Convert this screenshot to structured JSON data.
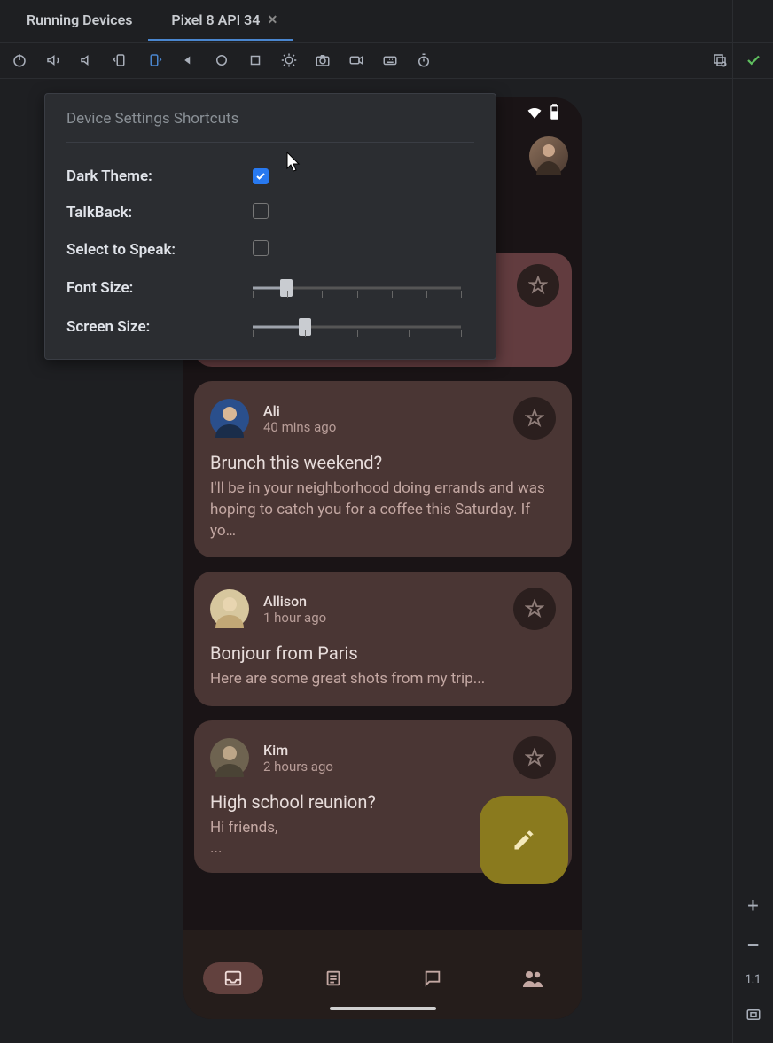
{
  "tabs": {
    "primary": "Running Devices",
    "active": "Pixel 8 API 34"
  },
  "toolbar_icons": [
    "power-icon",
    "volume-up-icon",
    "volume-down-icon",
    "rotate-left-icon",
    "rotate-right-icon",
    "back-icon",
    "home-icon",
    "overview-icon",
    "bug-icon",
    "camera-icon",
    "video-icon",
    "keyboard-icon",
    "timer-icon"
  ],
  "toolbar_right_icons": [
    "snapshot-icon",
    "check-icon"
  ],
  "settings": {
    "title": "Device Settings Shortcuts",
    "dark_theme": {
      "label": "Dark Theme:",
      "checked": true
    },
    "talkback": {
      "label": "TalkBack:",
      "checked": false
    },
    "select_to_speak": {
      "label": "Select to Speak:",
      "checked": false
    },
    "font_size": {
      "label": "Font Size:",
      "value": 1,
      "min": 0,
      "max": 6
    },
    "screen_size": {
      "label": "Screen Size:",
      "value": 1,
      "min": 0,
      "max": 4
    }
  },
  "phone": {
    "emails": [
      {
        "sender": "",
        "time": "",
        "subject": "",
        "snippet": "",
        "ellipsis": "...",
        "pinned": true,
        "avatar_color": "#7a5542"
      },
      {
        "sender": "Ali",
        "time": "40 mins ago",
        "subject": "Brunch this weekend?",
        "snippet": "I'll be in your neighborhood doing errands and was hoping to catch you for a coffee this Saturday. If yo…",
        "ellipsis": "",
        "pinned": false,
        "avatar_color": "#2a4f8c"
      },
      {
        "sender": "Allison",
        "time": "1 hour ago",
        "subject": "Bonjour from Paris",
        "snippet": "Here are some great shots from my trip...",
        "ellipsis": "",
        "pinned": false,
        "avatar_color": "#d7c79e"
      },
      {
        "sender": "Kim",
        "time": "2 hours ago",
        "subject": "High school reunion?",
        "snippet": "Hi friends,",
        "ellipsis": "...",
        "pinned": false,
        "avatar_color": "#6e6350"
      }
    ]
  },
  "sidebar": {
    "ratio": "1:1"
  }
}
